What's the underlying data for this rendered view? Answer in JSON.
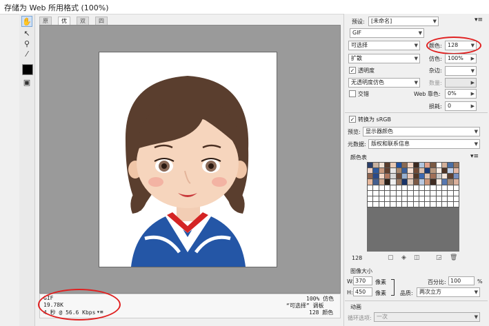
{
  "window": {
    "title": "存储为 Web 所用格式 (100%)"
  },
  "tools": [
    "hand-icon",
    "slice-select-icon",
    "zoom-icon",
    "eyedropper-icon",
    "color-swatch",
    "toggle-slices-icon"
  ],
  "view_tabs": [
    "原稿",
    "优化",
    "双联",
    "四联"
  ],
  "status": {
    "format": "GIF",
    "size": "19.78K",
    "speed": "4 秒 @ 56.6 Kbps",
    "speed_menu": "▾≡",
    "dither_pct": "100% 仿色",
    "palette_note": "“可选择” 调板",
    "colors_note": "128 颜色"
  },
  "settings": {
    "preset_label": "预设:",
    "preset_value": "[未命名]",
    "format": "GIF",
    "reduction": "可选择",
    "colors_label": "颜色:",
    "colors_value": "128",
    "dither_algo": "扩散",
    "dither_label": "仿色:",
    "dither_value": "100%",
    "transparency_label": "透明度",
    "matte_label": "杂边:",
    "transparency_dither": "无透明度仿色",
    "amount_label": "数量:",
    "interlaced_label": "交错",
    "web_snap_label": "Web 靠色:",
    "web_snap_value": "0%",
    "lossy_label": "损耗:",
    "lossy_value": "0",
    "convert_srgb_label": "转换为 sRGB",
    "preview_label": "预览:",
    "preview_value": "显示器颜色",
    "metadata_label": "元数据:",
    "metadata_value": "版权和联系信息"
  },
  "color_table": {
    "title": "颜色表",
    "count": "128",
    "swatches": [
      "#2a3f6b",
      "#c9b2a0",
      "#f2e2d4",
      "#5a3d2c",
      "#e8c9b4",
      "#1e4fa0",
      "#8a6a52",
      "#f5d6c4",
      "#3d2a20",
      "#b0c4de",
      "#e0a08a",
      "#7a5a44",
      "#ffffff",
      "#d4b09a",
      "#4a6fa5",
      "#9c7a62",
      "#f0d0c0",
      "#2e5a9e",
      "#c89a80",
      "#603f2e",
      "#e8e8e8",
      "#a8886e",
      "#3a5f9a",
      "#f8e4d8",
      "#704a36",
      "#dcc0ae",
      "#1c3c78",
      "#b89880",
      "#fdf0e8",
      "#4e3426",
      "#c0d0e8",
      "#e4b8a4",
      "#8c6450",
      "#2a4a88",
      "#f4d8c8",
      "#b07860",
      "#d8d8d8",
      "#6a4a38",
      "#98b0d0",
      "#ecc8b6",
      "#503828",
      "#3c68b0",
      "#e0c4b2",
      "#a07058",
      "#c8c8c8",
      "#f6e6dc",
      "#5c4030",
      "#7890c0",
      "#e8b89c",
      "#445e8e",
      "#d0a890",
      "#2c2018",
      "#f0f0f0",
      "#9a7a64",
      "#1a3468",
      "#e2ccbc",
      "#7c5a46",
      "#b8c8e0",
      "#cc9478",
      "#402c22",
      "#f8ece4",
      "#5878b0",
      "#a88c78",
      "#dab09c",
      "#fff",
      "#fff",
      "#fff",
      "#fff",
      "#fff",
      "#fff",
      "#fff",
      "#fff",
      "#fff",
      "#fff",
      "#fff",
      "#fff",
      "#fff",
      "#fff",
      "#fff",
      "#fff",
      "#fff",
      "#fff",
      "#fff",
      "#fff",
      "#fff",
      "#fff",
      "#fff",
      "#fff",
      "#fff",
      "#fff",
      "#fff",
      "#fff",
      "#fff",
      "#fff",
      "#fff",
      "#fff",
      "#fff",
      "#fff",
      "#fff",
      "#fff",
      "#fff",
      "#fff",
      "#fff",
      "#fff",
      "#fff",
      "#fff",
      "#fff",
      "#fff",
      "#fff",
      "#fff",
      "#fff",
      "#fff",
      "#fff",
      "#fff",
      "#fff",
      "#fff",
      "#fff",
      "#fff",
      "#fff",
      "#fff",
      "#fff",
      "#fff",
      "#fff",
      "#fff",
      "#fff",
      "#fff",
      "#fff",
      "#fff"
    ]
  },
  "image_size": {
    "title": "图像大小",
    "w_label": "W:",
    "w_value": "370",
    "h_label": "H:",
    "h_value": "450",
    "unit": "像素",
    "percent_label": "百分比:",
    "percent_value": "100",
    "percent_unit": "%",
    "quality_label": "品质:",
    "quality_value": "两次立方"
  },
  "animation": {
    "title": "动画",
    "loop_label": "循环选项:",
    "loop_value": "一次"
  }
}
